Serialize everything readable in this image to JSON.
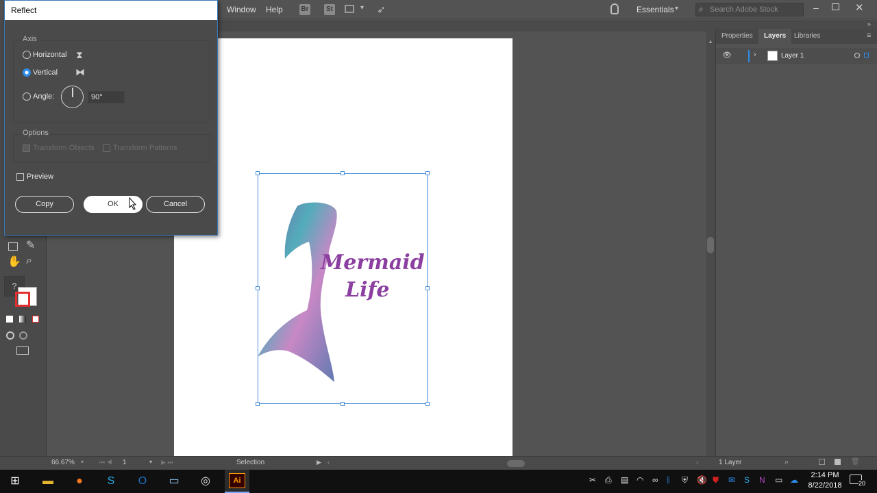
{
  "menubar": {
    "items": [
      "Window",
      "Help"
    ],
    "workspace": "Essentials",
    "search_placeholder": "Search Adobe Stock",
    "stock_icon_label": "St",
    "bridge_icon_label": "Br"
  },
  "dialog": {
    "title": "Reflect",
    "axis_label": "Axis",
    "horizontal_label": "Horizontal",
    "vertical_label": "Vertical",
    "selected_axis": "Vertical",
    "angle_label": "Angle:",
    "angle_value": "90°",
    "options_label": "Options",
    "transform_objects_label": "Transform Objects",
    "transform_patterns_label": "Transform Patterns",
    "preview_label": "Preview",
    "copy_button": "Copy",
    "ok_button": "OK",
    "cancel_button": "Cancel"
  },
  "artwork": {
    "text_line1": "Mermaid",
    "text_line2": "Life"
  },
  "right_panel": {
    "tabs": [
      "Properties",
      "Layers",
      "Libraries"
    ],
    "active_tab": "Layers",
    "layer_name": "Layer 1",
    "layer_count": "1 Layer"
  },
  "statusbar": {
    "zoom": "66.67%",
    "artboard_number": "1",
    "tool": "Selection"
  },
  "taskbar": {
    "time": "2:14 PM",
    "date": "8/22/2018",
    "notification_count": "20",
    "illustrator_label": "Ai"
  },
  "colors": {
    "accent": "#2d8ceb",
    "ui_bg": "#535353",
    "selection": "#4a90d9",
    "illustrator_orange": "#ff9a00"
  }
}
